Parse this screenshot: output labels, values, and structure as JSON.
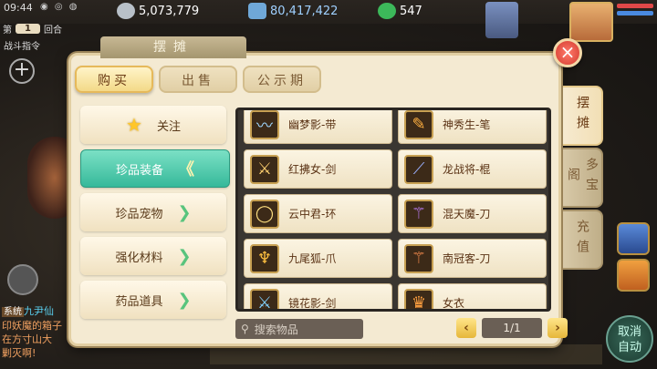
{
  "status": {
    "time": "09:44",
    "round_prefix": "第",
    "round_num": "1",
    "round_suffix": "回合",
    "battle_cmd": "战斗指令"
  },
  "currencies": [
    {
      "name": "silver",
      "value": "5,073,779",
      "color": "#cfd6df"
    },
    {
      "name": "gold",
      "value": "80,417,422",
      "color": "#9fd0ff"
    },
    {
      "name": "jade",
      "value": "547",
      "color": "#5ad07a"
    }
  ],
  "panel": {
    "title": "摆摊",
    "close_symbol": "×"
  },
  "tabs": [
    {
      "label": "购买",
      "active": true
    },
    {
      "label": "出售",
      "active": false
    },
    {
      "label": "公示期",
      "active": false
    }
  ],
  "categories": [
    {
      "label": "关注",
      "icon": "star-icon",
      "active": false
    },
    {
      "label": "珍品装备",
      "active": true
    },
    {
      "label": "珍品宠物",
      "active": false
    },
    {
      "label": "强化材料",
      "active": false
    },
    {
      "label": "药品道具",
      "active": false
    }
  ],
  "items": [
    {
      "name": "幽梦影-带",
      "icon": "belt-icon"
    },
    {
      "name": "神秀生-笔",
      "icon": "brush-icon"
    },
    {
      "name": "红拂女-剑",
      "icon": "sword-icon"
    },
    {
      "name": "龙战将-棍",
      "icon": "staff-icon"
    },
    {
      "name": "云中君-环",
      "icon": "ring-icon"
    },
    {
      "name": "混天魔-刀",
      "icon": "blade-icon"
    },
    {
      "name": "九尾狐-爪",
      "icon": "claw-icon"
    },
    {
      "name": "南冠客-刀",
      "icon": "blade-icon"
    },
    {
      "name": "镜花影-剑",
      "icon": "sword-icon"
    },
    {
      "name": "女衣",
      "icon": "robe-icon"
    }
  ],
  "search": {
    "placeholder": "搜索物品"
  },
  "pager": {
    "label": "1/1",
    "prev": "‹",
    "next": "›"
  },
  "side_tabs": [
    {
      "label": "摆摊",
      "active": true
    },
    {
      "label": "多宝阁",
      "active": false
    },
    {
      "label": "充值",
      "active": false
    }
  ],
  "chat": {
    "sys_tag": "系统",
    "name": "九尹仙",
    "line1": "印妖魔的箱子",
    "line2": "在方寸山大",
    "line3": "剿灭啊!"
  },
  "auto_btn": {
    "line1": "取消",
    "line2": "自动"
  }
}
